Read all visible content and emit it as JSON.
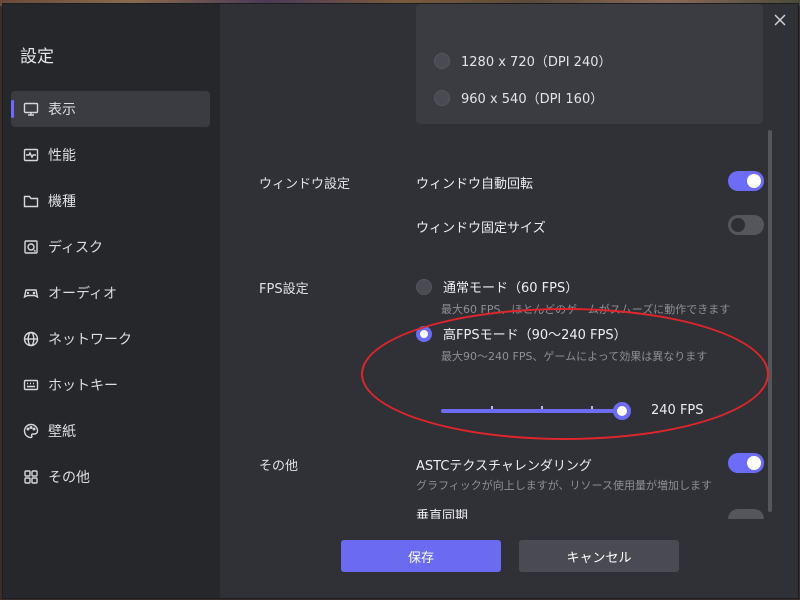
{
  "sidebar": {
    "title": "設定",
    "items": [
      {
        "label": "表示",
        "icon": "monitor-icon",
        "active": true
      },
      {
        "label": "性能",
        "icon": "pulse-icon"
      },
      {
        "label": "機種",
        "icon": "folder-icon"
      },
      {
        "label": "ディスク",
        "icon": "disk-icon"
      },
      {
        "label": "オーディオ",
        "icon": "gamepad-icon"
      },
      {
        "label": "ネットワーク",
        "icon": "globe-icon"
      },
      {
        "label": "ホットキー",
        "icon": "keyboard-icon"
      },
      {
        "label": "壁紙",
        "icon": "palette-icon"
      },
      {
        "label": "その他",
        "icon": "grid-icon"
      }
    ]
  },
  "resolution": {
    "options": [
      {
        "label": "1280 x 720（DPI 240）",
        "selected": false
      },
      {
        "label": "960 x 540（DPI 160）",
        "selected": false
      }
    ]
  },
  "window_settings": {
    "section_label": "ウィンドウ設定",
    "auto_rotate": {
      "label": "ウィンドウ自動回転",
      "enabled": true
    },
    "fixed_size": {
      "label": "ウィンドウ固定サイズ",
      "enabled": false
    }
  },
  "fps_settings": {
    "section_label": "FPS設定",
    "normal": {
      "label": "通常モード（60 FPS）",
      "desc": "最大60 FPS、ほとんどのゲームがスムーズに動作できます",
      "selected": false
    },
    "high": {
      "label": "高FPSモード（90～240 FPS）",
      "desc": "最大90～240 FPS、ゲームによって効果は異なります",
      "selected": true
    },
    "slider_value": "240 FPS",
    "slider_fraction": 1.0
  },
  "other": {
    "section_label": "その他",
    "astc": {
      "label": "ASTCテクスチャレンダリング",
      "desc": "グラフィックが向上しますが、リソース使用量が増加します",
      "enabled": true
    },
    "vsync": {
      "label": "垂直同期"
    }
  },
  "footer": {
    "save_label": "保存",
    "cancel_label": "キャンセル"
  },
  "colors": {
    "accent": "#6c6cf6",
    "annotation": "#e0262a"
  }
}
